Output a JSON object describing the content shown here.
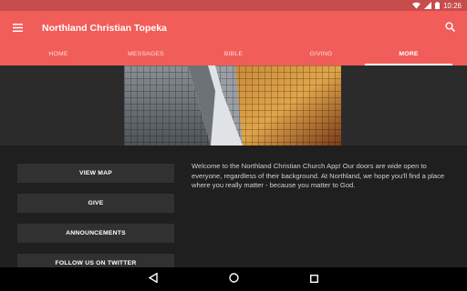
{
  "status": {
    "time": "10:26"
  },
  "app": {
    "title": "Northland Christian Topeka"
  },
  "tabs": [
    {
      "label": "HOME"
    },
    {
      "label": "MESSAGES"
    },
    {
      "label": "BIBLE"
    },
    {
      "label": "GIVING"
    },
    {
      "label": "MORE"
    }
  ],
  "active_tab": "MORE",
  "buttons": [
    {
      "label": "VIEW MAP"
    },
    {
      "label": "GIVE"
    },
    {
      "label": "ANNOUNCEMENTS"
    },
    {
      "label": "FOLLOW US ON TWITTER"
    }
  ],
  "welcome_text": "Welcome to the Northland Christian Church App!  Our doors are wide open to everyone, regardless of their background.  At Northland, we hope you'll find a place where you really matter - because you matter to God.",
  "colors": {
    "app_bar": "#f15d59",
    "status_bar": "#c64d4b",
    "background": "#1f1f1f",
    "button": "#313131"
  },
  "icons": [
    "menu-icon",
    "search-icon",
    "wifi-icon",
    "signal-icon",
    "battery-icon",
    "back-icon",
    "home-icon",
    "recents-icon"
  ]
}
